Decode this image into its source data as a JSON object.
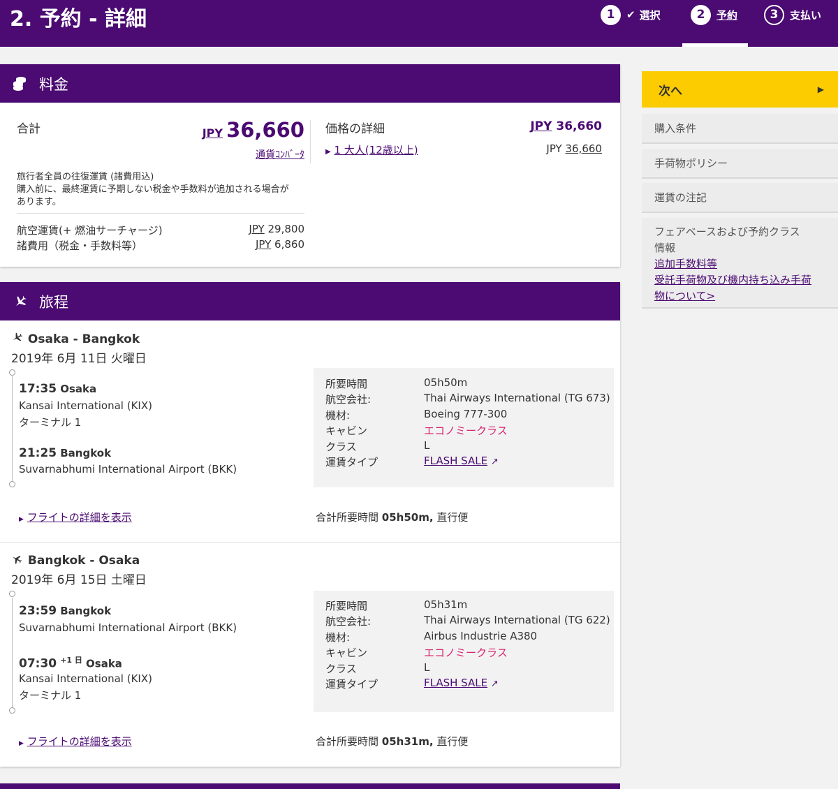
{
  "header": {
    "title": "2. 予約 - 詳細",
    "steps": [
      {
        "num": "1",
        "label": "選択"
      },
      {
        "num": "2",
        "label": "予約"
      },
      {
        "num": "3",
        "label": "支払い"
      }
    ]
  },
  "fare": {
    "heading": "料金",
    "total_label": "合計",
    "currency": "JPY",
    "total_amount": "36,660",
    "converter_link": "通貨ｺﾝﾊﾞｰﾀ",
    "note": "旅行者全員の往復運賃 (諸費用込)",
    "note2": "購入前に、最終運賃に予期しない税金や手数料が追加される場合が",
    "note3": "あります。",
    "airfare_label": "航空運賃(+ 燃油サーチャージ)",
    "airfare_currency": "JPY",
    "airfare_value": "29,800",
    "fees_label": "諸費用（税金・手数料等）",
    "fees_currency": "JPY",
    "fees_value": "6,860",
    "detail_label": "価格の詳細",
    "detail_currency": "JPY",
    "detail_amount": "36,660",
    "pax_label": "1 大人(12歳以上)",
    "pax_currency": "JPY",
    "pax_amount": "36,660"
  },
  "itinerary": {
    "heading": "旅程",
    "flights": [
      {
        "route": "Osaka - Bangkok",
        "date": "2019年 6月 11日 火曜日",
        "dep_time": "17:35",
        "dep_city": "Osaka",
        "dep_airport": "Kansai International (KIX)",
        "dep_terminal": "ターミナル 1",
        "arr_time": "21:25",
        "arr_day": "",
        "arr_city": "Bangkok",
        "arr_airport": "Suvarnabhumi International Airport (BKK)",
        "arr_terminal": "",
        "labels": [
          "所要時間",
          "航空会社:",
          "機材:",
          "キャビン",
          "クラス",
          "運賃タイプ"
        ],
        "duration": "05h50m",
        "airline": "Thai Airways International (TG 673)",
        "aircraft": "Boeing 777-300",
        "cabin": "エコノミークラス",
        "class": "L",
        "fare_type": "FLASH SALE",
        "details_link": "フライトの詳細を表示",
        "total_duration_label": "合計所要時間",
        "total_duration": "05h50m,",
        "nonstop": "直行便"
      },
      {
        "route": "Bangkok - Osaka",
        "date": "2019年 6月 15日 土曜日",
        "dep_time": "23:59",
        "dep_city": "Bangkok",
        "dep_airport": "Suvarnabhumi International Airport (BKK)",
        "dep_terminal": "",
        "arr_time": "07:30",
        "arr_day": "+1 日",
        "arr_city": "Osaka",
        "arr_airport": "Kansai International (KIX)",
        "arr_terminal": "ターミナル 1",
        "labels": [
          "所要時間",
          "航空会社:",
          "機材:",
          "キャビン",
          "クラス",
          "運賃タイプ"
        ],
        "duration": "05h31m",
        "airline": "Thai Airways International (TG 622)",
        "aircraft": "Airbus Industrie A380",
        "cabin": "エコノミークラス",
        "class": "L",
        "fare_type": "FLASH SALE",
        "details_link": "フライトの詳細を表示",
        "total_duration_label": "合計所要時間",
        "total_duration": "05h31m,",
        "nonstop": "直行便"
      }
    ]
  },
  "sidebar": {
    "next_label": "次へ",
    "purchase_terms": "購入条件",
    "baggage_policy": "手荷物ポリシー",
    "fare_notes": "運賃の注記",
    "farebasis_text1": "フェアベースおよび予約クラス",
    "farebasis_text2": "情報",
    "extra_fees_link": "追加手数料等",
    "checked_baggage_link1": "受託手荷物及び機内持ち込み手荷",
    "checked_baggage_link2": "物について>"
  },
  "colors": {
    "brand": "#4b0b72",
    "accent": "#fccc00",
    "cabin": "#d6246e"
  }
}
